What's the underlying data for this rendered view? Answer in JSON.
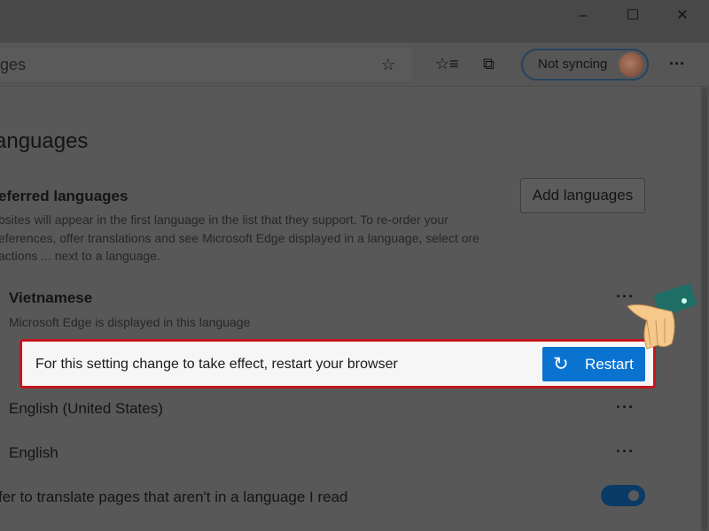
{
  "window": {
    "minimize": "–",
    "maximize": "☐",
    "close": "✕"
  },
  "toolbar": {
    "address_text": "ges",
    "sync_label": "Not syncing",
    "more": "···"
  },
  "page": {
    "title": "anguages",
    "section_title": "eferred languages",
    "section_desc": "bsites will appear in the first language in the list that they support. To re-order your eferences, offer translations and see Microsoft Edge displayed in a language, select ore actions ... next to a language.",
    "add_languages": "Add languages",
    "languages": [
      {
        "name": "Vietnamese",
        "note": "Microsoft Edge is displayed in this language"
      },
      {
        "name": "English (United States)"
      },
      {
        "name": "English"
      }
    ],
    "more": "···",
    "translate_label": "fer to translate pages that aren't in a language I read",
    "translate_on": true
  },
  "banner": {
    "message": "For this setting change to take effect, restart your browser",
    "restart_label": "Restart"
  },
  "colors": {
    "accent": "#0a72cf",
    "highlight": "#c4161c"
  }
}
